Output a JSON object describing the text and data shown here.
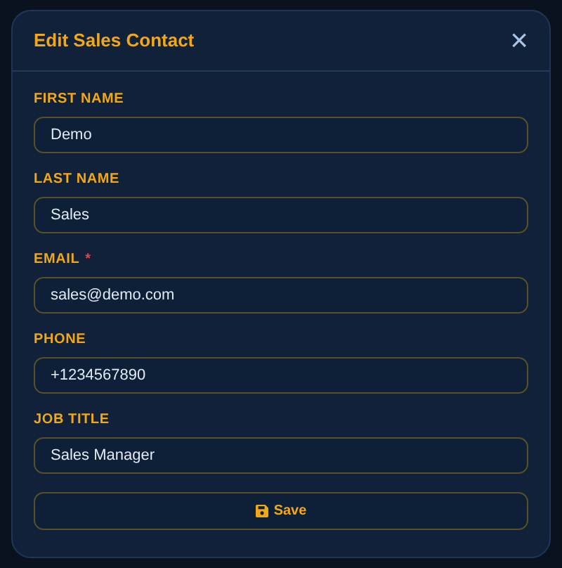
{
  "dialog": {
    "title": "Edit Sales Contact",
    "close": "×"
  },
  "fields": [
    {
      "label": "FIRST NAME",
      "value": "Demo"
    },
    {
      "label": "LAST NAME",
      "value": "Sales"
    },
    {
      "label": "EMAIL",
      "required_mark": "*",
      "value": "sales@demo.com"
    },
    {
      "label": "PHONE",
      "value": "+1234567890"
    },
    {
      "label": "JOB TITLE",
      "value": "Sales Manager"
    }
  ],
  "save_button": {
    "label": "Save"
  }
}
